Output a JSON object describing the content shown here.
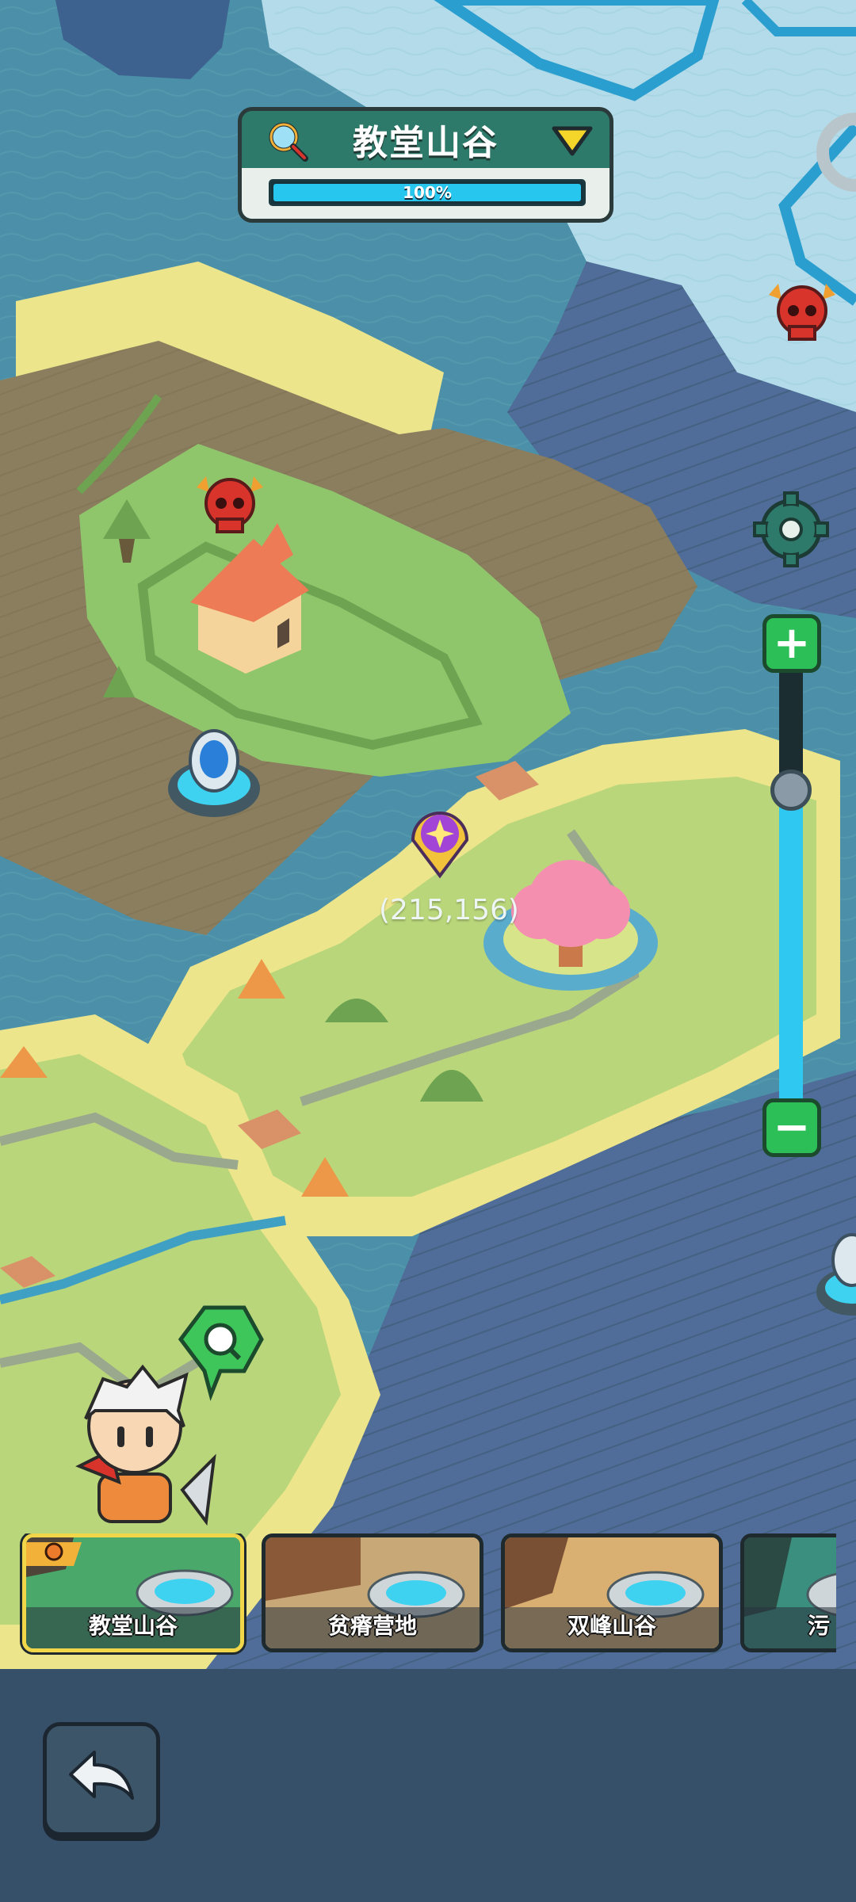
{
  "region": {
    "name": "教堂山谷",
    "progress_text": "100%",
    "progress_fraction": 1.0
  },
  "map": {
    "coordinates": "(215,156)"
  },
  "zoom": {
    "level_fraction": 0.72
  },
  "location_cards": [
    {
      "label": "教堂山谷",
      "selected": true
    },
    {
      "label": "贫瘠营地",
      "selected": false
    },
    {
      "label": "双峰山谷",
      "selected": false
    },
    {
      "label": "污",
      "selected": false
    }
  ],
  "icons": {
    "search": "magnifier-icon",
    "dropdown": "triangle-down-icon",
    "settings": "gear-icon",
    "enemy": "red-demon-skull-icon",
    "waypoint": "purple-star-pin-icon",
    "back": "return-arrow-icon"
  },
  "colors": {
    "progress": "#27c6ee",
    "zoom_button": "#2dbf57",
    "selected_card_border": "#f1d64a"
  }
}
